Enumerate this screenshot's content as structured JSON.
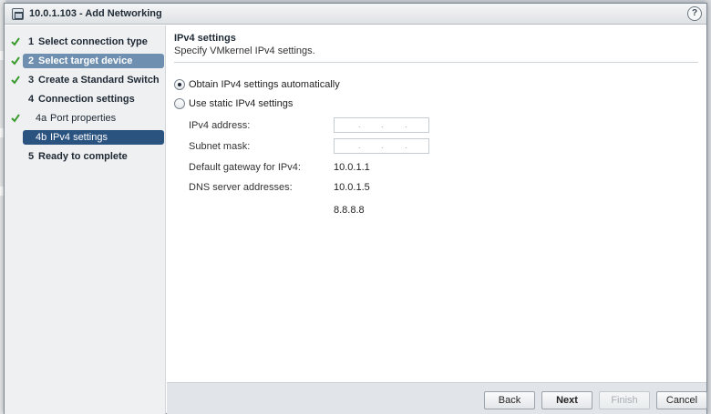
{
  "window": {
    "title": "10.0.1.103 - Add Networking",
    "help_label": "?"
  },
  "steps": [
    {
      "num": "1",
      "label": "Select connection type",
      "completed": true
    },
    {
      "num": "2",
      "label": "Select target device",
      "completed": true
    },
    {
      "num": "3",
      "label": "Create a Standard Switch",
      "completed": true
    },
    {
      "num": "4",
      "label": "Connection settings",
      "completed": false
    },
    {
      "num": "4a",
      "label": "Port properties",
      "completed": true
    },
    {
      "num": "4b",
      "label": "IPv4 settings",
      "completed": false,
      "selected": true
    },
    {
      "num": "5",
      "label": "Ready to complete",
      "completed": false
    }
  ],
  "content": {
    "title": "IPv4 settings",
    "subtitle": "Specify VMkernel IPv4 settings.",
    "options": [
      {
        "label": "Obtain IPv4 settings automatically",
        "selected": true
      },
      {
        "label": "Use static IPv4 settings",
        "selected": false
      }
    ],
    "fields": {
      "ipv4_address_label": "IPv4 address:",
      "subnet_mask_label": "Subnet mask:",
      "gateway_label": "Default gateway for IPv4:",
      "gateway_value": "10.0.1.1",
      "dns_label": "DNS server addresses:",
      "dns_values": [
        "10.0.1.5",
        "8.8.8.8"
      ]
    }
  },
  "footer": {
    "back_label": "Back",
    "next_label": "Next",
    "finish_label": "Finish",
    "cancel_label": "Cancel"
  },
  "colors": {
    "selected_step": "#2b5380",
    "highlight_step": "#6e8fb0",
    "check_green": "#3a9a2e"
  }
}
